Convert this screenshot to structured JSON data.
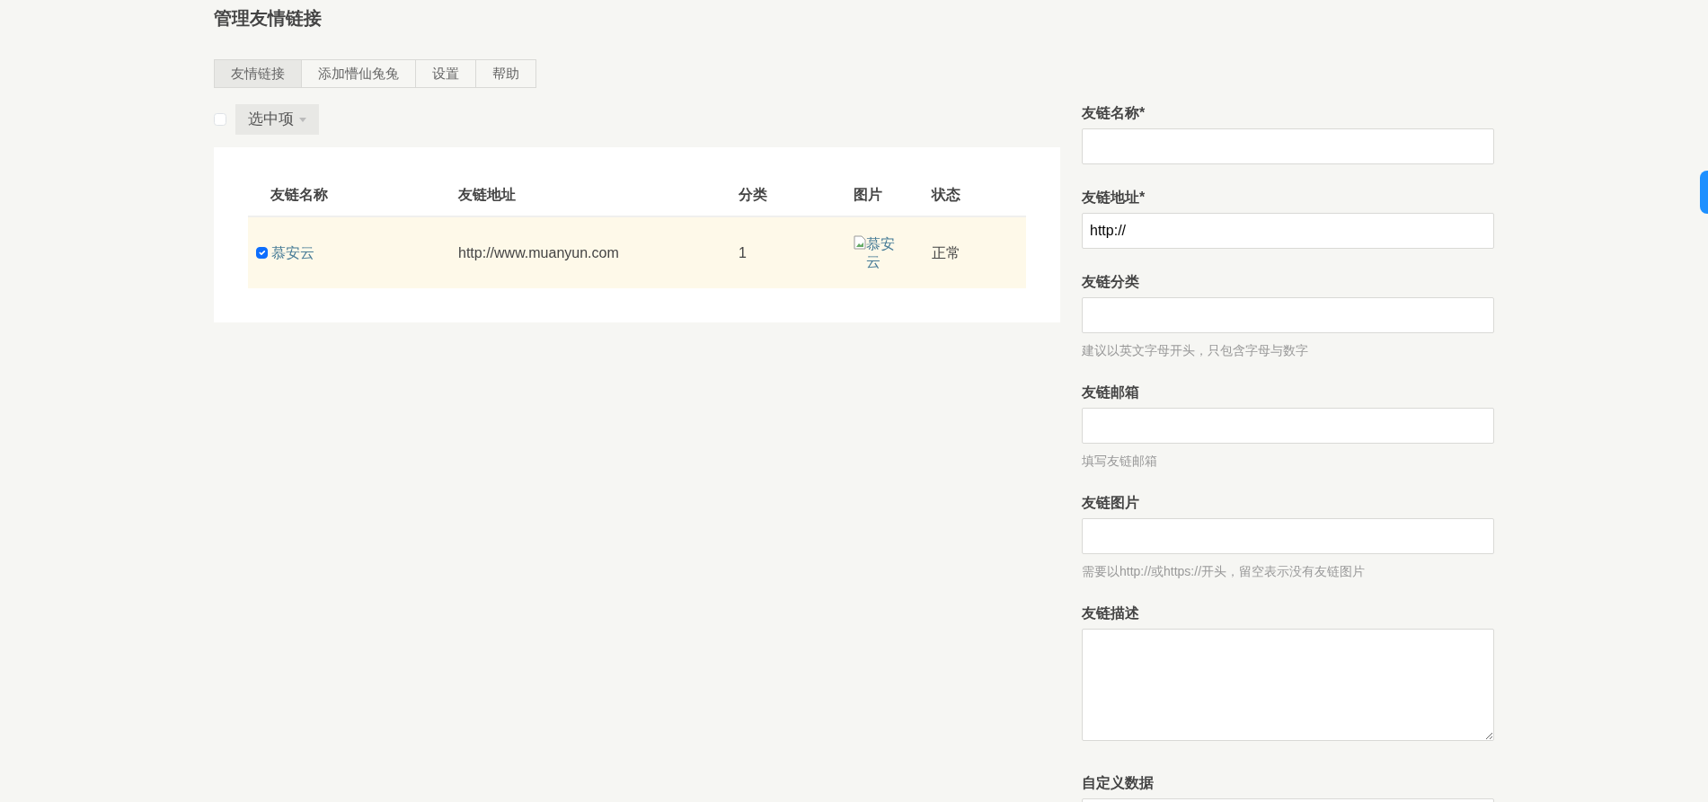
{
  "page_title": "管理友情链接",
  "tabs": [
    {
      "label": "友情链接",
      "selected": true
    },
    {
      "label": "添加懵仙兔兔",
      "selected": false
    },
    {
      "label": "设置",
      "selected": false
    },
    {
      "label": "帮助",
      "selected": false
    }
  ],
  "bulk": {
    "checked": false,
    "label": "选中项"
  },
  "table": {
    "columns": [
      "友链名称",
      "友链地址",
      "分类",
      "图片",
      "状态"
    ],
    "rows": [
      {
        "checked": true,
        "name": "慕安云",
        "url": "http://www.muanyun.com",
        "category": "1",
        "image_alt": "慕安云",
        "status": "正常"
      }
    ]
  },
  "form": {
    "fields": [
      {
        "label": "友链名称*",
        "kind": "input"
      },
      {
        "label": "友链地址*",
        "kind": "input",
        "value": "http://"
      },
      {
        "label": "友链分类",
        "kind": "input",
        "hint": "建议以英文字母开头，只包含字母与数字"
      },
      {
        "label": "友链邮箱",
        "kind": "input",
        "hint": "填写友链邮箱"
      },
      {
        "label": "友链图片",
        "kind": "input",
        "hint": "需要以http://或https://开头，留空表示没有友链图片"
      },
      {
        "label": "友链描述",
        "kind": "textarea"
      },
      {
        "label": "自定义数据",
        "kind": "input"
      }
    ]
  }
}
